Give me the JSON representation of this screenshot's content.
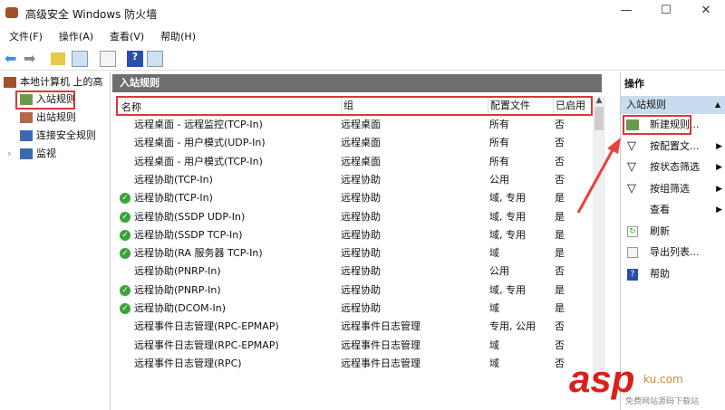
{
  "window": {
    "title": "高级安全 Windows 防火墙",
    "minimize": "—",
    "maximize": "☐",
    "close": "✕"
  },
  "menu": [
    "文件(F)",
    "操作(A)",
    "查看(V)",
    "帮助(H)"
  ],
  "tree": {
    "root": "本地计算机 上的高",
    "items": [
      "入站规则",
      "出站规则",
      "连接安全规则",
      "监视"
    ],
    "expand": "›"
  },
  "center": {
    "title": "入站规则",
    "columns": [
      "名称",
      "组",
      "配置文件",
      "已启用"
    ],
    "rows": [
      {
        "name": "远程桌面 - 远程监控(TCP-In)",
        "group": "远程桌面",
        "profile": "所有",
        "enabled": "否",
        "on": false
      },
      {
        "name": "远程桌面 - 用户模式(UDP-In)",
        "group": "远程桌面",
        "profile": "所有",
        "enabled": "否",
        "on": false
      },
      {
        "name": "远程桌面 - 用户模式(TCP-In)",
        "group": "远程桌面",
        "profile": "所有",
        "enabled": "否",
        "on": false
      },
      {
        "name": "远程协助(TCP-In)",
        "group": "远程协助",
        "profile": "公用",
        "enabled": "否",
        "on": false
      },
      {
        "name": "远程协助(TCP-In)",
        "group": "远程协助",
        "profile": "域, 专用",
        "enabled": "是",
        "on": true
      },
      {
        "name": "远程协助(SSDP UDP-In)",
        "group": "远程协助",
        "profile": "域, 专用",
        "enabled": "是",
        "on": true
      },
      {
        "name": "远程协助(SSDP TCP-In)",
        "group": "远程协助",
        "profile": "域, 专用",
        "enabled": "是",
        "on": true
      },
      {
        "name": "远程协助(RA 服务器 TCP-In)",
        "group": "远程协助",
        "profile": "域",
        "enabled": "是",
        "on": true
      },
      {
        "name": "远程协助(PNRP-In)",
        "group": "远程协助",
        "profile": "公用",
        "enabled": "否",
        "on": false
      },
      {
        "name": "远程协助(PNRP-In)",
        "group": "远程协助",
        "profile": "域, 专用",
        "enabled": "是",
        "on": true
      },
      {
        "name": "远程协助(DCOM-In)",
        "group": "远程协助",
        "profile": "域",
        "enabled": "是",
        "on": true
      },
      {
        "name": "远程事件日志管理(RPC-EPMAP)",
        "group": "远程事件日志管理",
        "profile": "专用, 公用",
        "enabled": "否",
        "on": false
      },
      {
        "name": "远程事件日志管理(RPC-EPMAP)",
        "group": "远程事件日志管理",
        "profile": "域",
        "enabled": "否",
        "on": false
      },
      {
        "name": "远程事件日志管理(RPC)",
        "group": "远程事件日志管理",
        "profile": "域",
        "enabled": "否",
        "on": false
      }
    ]
  },
  "actions": {
    "title": "操作",
    "section": "入站规则",
    "items": [
      {
        "label": "新建规则...",
        "icon": "new-rule-icon",
        "sub": false
      },
      {
        "label": "按配置文...",
        "icon": "filter-icon",
        "sub": true
      },
      {
        "label": "按状态筛选",
        "icon": "filter-icon",
        "sub": true
      },
      {
        "label": "按组筛选",
        "icon": "filter-icon",
        "sub": true
      },
      {
        "label": "查看",
        "icon": "",
        "sub": true
      },
      {
        "label": "刷新",
        "icon": "refresh-icon",
        "sub": false
      },
      {
        "label": "导出列表...",
        "icon": "export-icon",
        "sub": false
      },
      {
        "label": "帮助",
        "icon": "help-icon",
        "sub": false
      }
    ]
  },
  "watermark": {
    "brand": "asp",
    "sub": "免费网站源码下载站",
    "domain": "ku.com .net"
  }
}
